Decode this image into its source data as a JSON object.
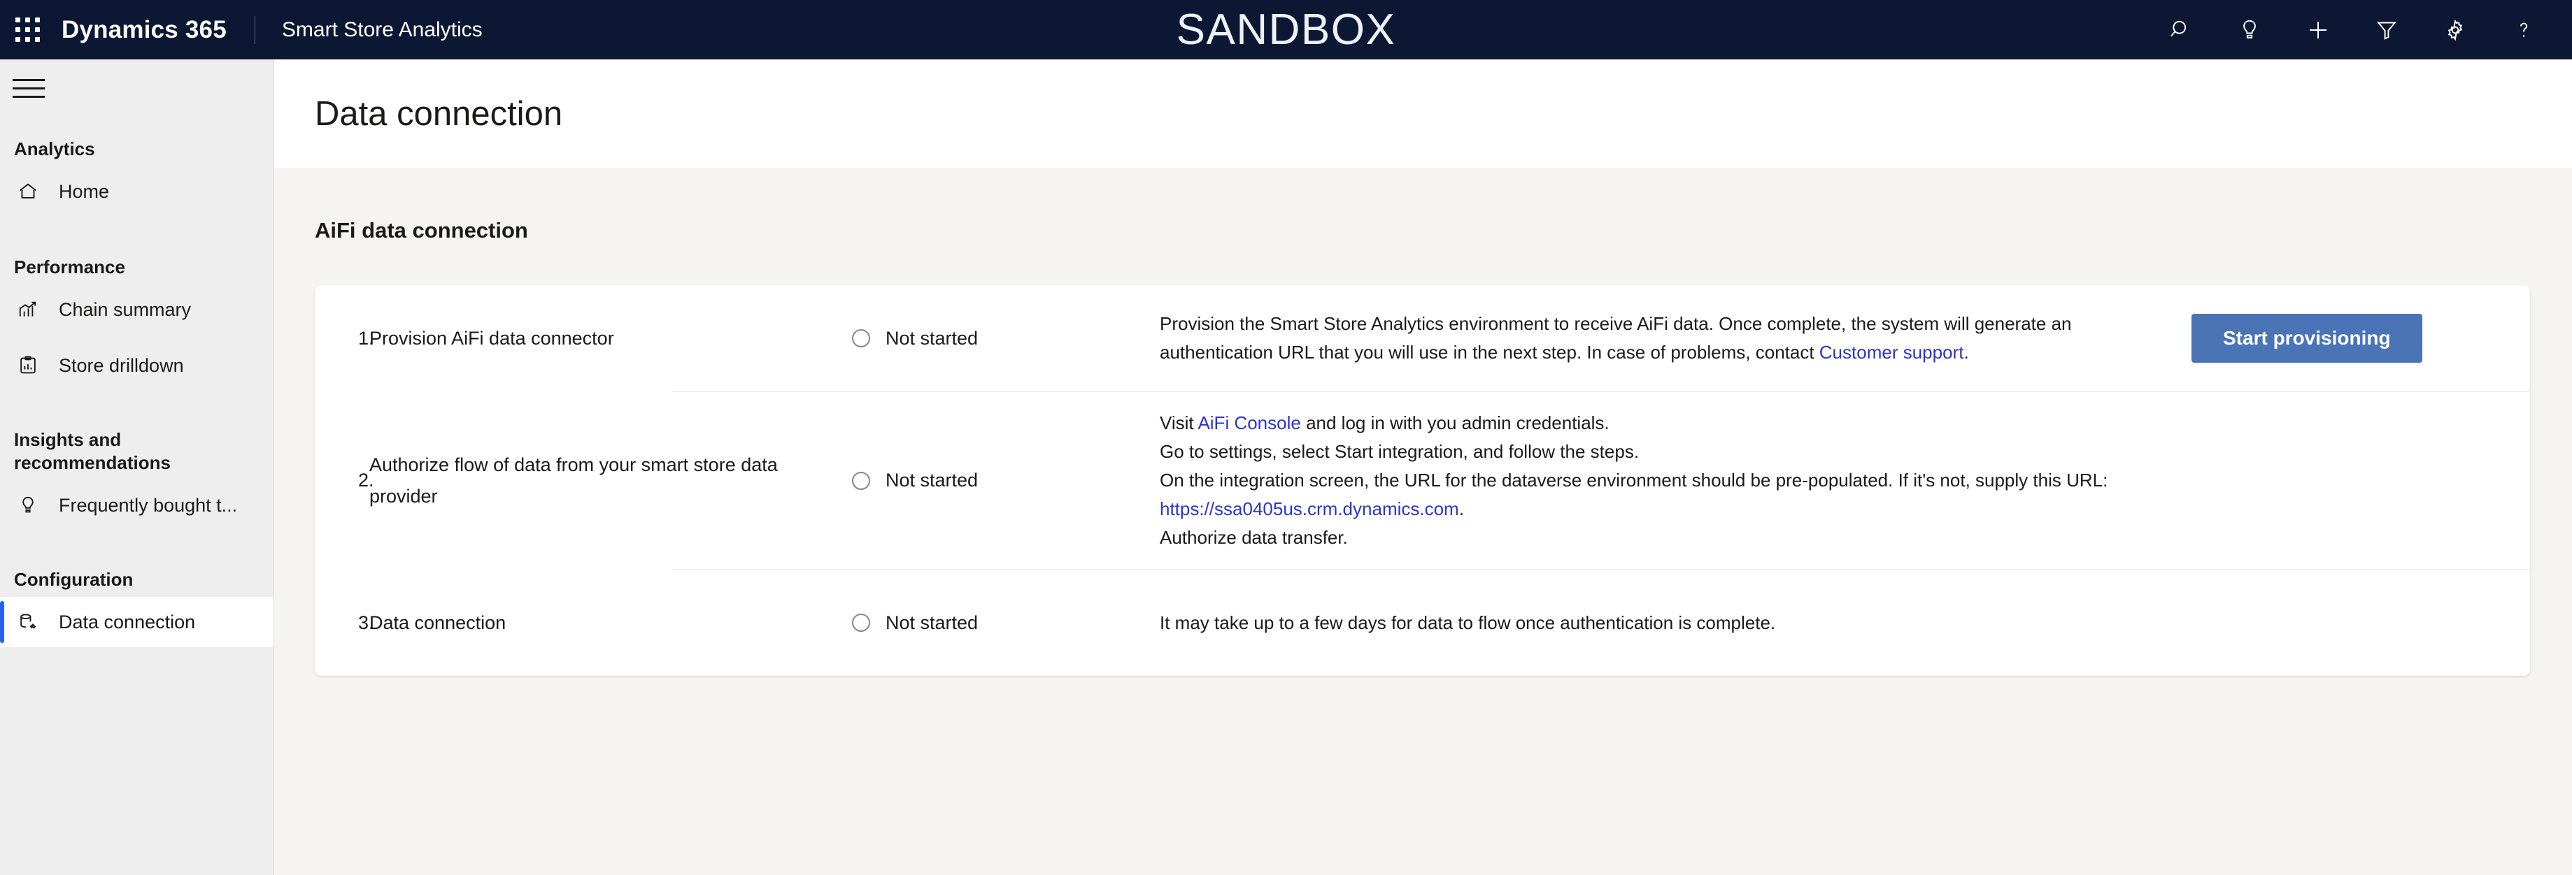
{
  "topbar": {
    "waffle_icon": "waffle-grid-icon",
    "brand": "Dynamics 365",
    "app_name": "Smart Store Analytics",
    "environment_banner": "SANDBOX",
    "actions": [
      {
        "name": "search-icon",
        "label": "Search"
      },
      {
        "name": "lightbulb-icon",
        "label": "Insights"
      },
      {
        "name": "plus-icon",
        "label": "New"
      },
      {
        "name": "filter-icon",
        "label": "Filter"
      },
      {
        "name": "gear-icon",
        "label": "Settings"
      },
      {
        "name": "help-icon",
        "label": "Help"
      }
    ],
    "background": "#0b1733"
  },
  "sidebar": {
    "hamburger_icon": "hamburger-menu-icon",
    "groups": [
      {
        "title": "Analytics",
        "items": [
          {
            "label": "Home",
            "icon": "home-icon",
            "selected": false
          }
        ]
      },
      {
        "title": "Performance",
        "items": [
          {
            "label": "Chain summary",
            "icon": "trending-chart-icon",
            "selected": false
          },
          {
            "label": "Store drilldown",
            "icon": "clipboard-chart-icon",
            "selected": false
          }
        ]
      },
      {
        "title": "Insights and recommendations",
        "items": [
          {
            "label": "Frequently bought t...",
            "icon": "lightbulb-icon",
            "selected": false
          }
        ]
      },
      {
        "title": "Configuration",
        "items": [
          {
            "label": "Data connection",
            "icon": "database-plug-icon",
            "selected": true
          }
        ]
      }
    ],
    "selected_accent": "#2563eb",
    "background": "#eeeeee"
  },
  "main": {
    "page_title": "Data connection",
    "section_title": "AiFi data connection",
    "steps": [
      {
        "number": "1.",
        "name": "Provision AiFi data connector",
        "status": "Not started",
        "desc_parts": [
          {
            "type": "text",
            "text": "Provision the Smart Store Analytics environment to receive AiFi data. Once complete, the system will generate an authentication URL that you will use in the next step. In case of problems, contact "
          },
          {
            "type": "link",
            "text": "Customer support"
          },
          {
            "type": "text",
            "text": "."
          }
        ],
        "action_label": "Start provisioning"
      },
      {
        "number": "2.",
        "name": "Authorize flow of data from your smart store data provider",
        "status": "Not started",
        "desc_parts": [
          {
            "type": "text",
            "text": "Visit "
          },
          {
            "type": "link",
            "text": "AiFi Console"
          },
          {
            "type": "text",
            "text": " and log in with you admin credentials."
          },
          {
            "type": "break"
          },
          {
            "type": "text",
            "text": "Go to settings, select Start integration, and follow the steps."
          },
          {
            "type": "break"
          },
          {
            "type": "text",
            "text": "On the integration screen, the URL for the dataverse environment should be pre-populated. If it's not, supply this URL:"
          },
          {
            "type": "break"
          },
          {
            "type": "link",
            "text": "https://ssa0405us.crm.dynamics.com"
          },
          {
            "type": "text",
            "text": "."
          },
          {
            "type": "break"
          },
          {
            "type": "text",
            "text": "Authorize data transfer."
          }
        ],
        "action_label": ""
      },
      {
        "number": "3.",
        "name": "Data connection",
        "status": "Not started",
        "desc_parts": [
          {
            "type": "text",
            "text": "It may take up to a few days for data to flow once authentication is complete."
          }
        ],
        "action_label": ""
      }
    ],
    "colors": {
      "link": "#2b35d0",
      "button_primary": "#4a74b5",
      "card_background": "#ffffff",
      "page_background": "#f5f4f3"
    }
  }
}
